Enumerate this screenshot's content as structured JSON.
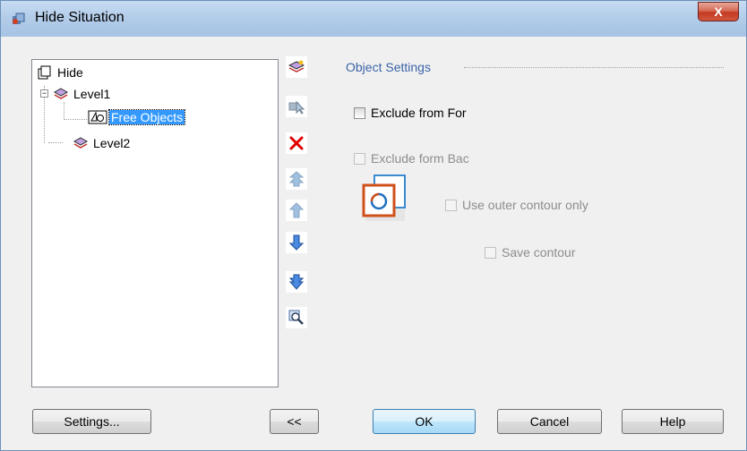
{
  "window": {
    "title": "Hide Situation",
    "close_glyph": "X"
  },
  "tree": {
    "items": [
      {
        "label": "Hide",
        "icon": "hide-root-icon"
      },
      {
        "label": "Level1",
        "icon": "layer-stack-icon",
        "expander": "−"
      },
      {
        "label": "Free Objects",
        "icon": "free-objects-icon",
        "selected": true
      },
      {
        "label": "Level2",
        "icon": "layer-stack-icon"
      }
    ]
  },
  "toolbar": {
    "icons": [
      "add-level-icon",
      "add-object-icon",
      "delete-icon",
      "move-top-icon",
      "move-up-icon",
      "move-down-icon",
      "move-bottom-icon",
      "zoom-icon"
    ]
  },
  "object_settings": {
    "title": "Object Settings",
    "exclude_front": "Exclude from For",
    "exclude_back": "Exclude form Bac",
    "use_outer_contour": "Use outer contour only",
    "save_contour": "Save contour",
    "preview_icon": "contour-preview-icon"
  },
  "buttons": {
    "settings": "Settings...",
    "collapse": "<<",
    "ok": "OK",
    "cancel": "Cancel",
    "help": "Help"
  },
  "colors": {
    "section_title": "#3c64a8",
    "selection": "#3399ff",
    "delete": "#e00000"
  }
}
